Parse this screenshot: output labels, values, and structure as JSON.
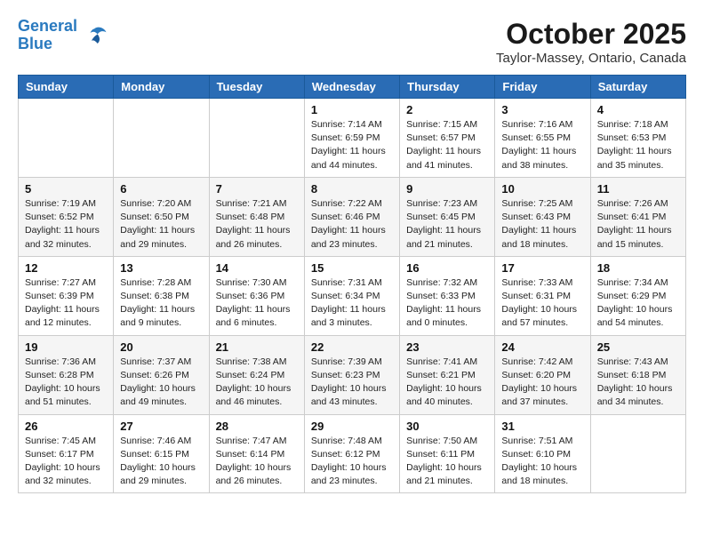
{
  "header": {
    "logo_line1": "General",
    "logo_line2": "Blue",
    "month_title": "October 2025",
    "location": "Taylor-Massey, Ontario, Canada"
  },
  "weekdays": [
    "Sunday",
    "Monday",
    "Tuesday",
    "Wednesday",
    "Thursday",
    "Friday",
    "Saturday"
  ],
  "weeks": [
    [
      {
        "day": "",
        "info": ""
      },
      {
        "day": "",
        "info": ""
      },
      {
        "day": "",
        "info": ""
      },
      {
        "day": "1",
        "info": "Sunrise: 7:14 AM\nSunset: 6:59 PM\nDaylight: 11 hours\nand 44 minutes."
      },
      {
        "day": "2",
        "info": "Sunrise: 7:15 AM\nSunset: 6:57 PM\nDaylight: 11 hours\nand 41 minutes."
      },
      {
        "day": "3",
        "info": "Sunrise: 7:16 AM\nSunset: 6:55 PM\nDaylight: 11 hours\nand 38 minutes."
      },
      {
        "day": "4",
        "info": "Sunrise: 7:18 AM\nSunset: 6:53 PM\nDaylight: 11 hours\nand 35 minutes."
      }
    ],
    [
      {
        "day": "5",
        "info": "Sunrise: 7:19 AM\nSunset: 6:52 PM\nDaylight: 11 hours\nand 32 minutes."
      },
      {
        "day": "6",
        "info": "Sunrise: 7:20 AM\nSunset: 6:50 PM\nDaylight: 11 hours\nand 29 minutes."
      },
      {
        "day": "7",
        "info": "Sunrise: 7:21 AM\nSunset: 6:48 PM\nDaylight: 11 hours\nand 26 minutes."
      },
      {
        "day": "8",
        "info": "Sunrise: 7:22 AM\nSunset: 6:46 PM\nDaylight: 11 hours\nand 23 minutes."
      },
      {
        "day": "9",
        "info": "Sunrise: 7:23 AM\nSunset: 6:45 PM\nDaylight: 11 hours\nand 21 minutes."
      },
      {
        "day": "10",
        "info": "Sunrise: 7:25 AM\nSunset: 6:43 PM\nDaylight: 11 hours\nand 18 minutes."
      },
      {
        "day": "11",
        "info": "Sunrise: 7:26 AM\nSunset: 6:41 PM\nDaylight: 11 hours\nand 15 minutes."
      }
    ],
    [
      {
        "day": "12",
        "info": "Sunrise: 7:27 AM\nSunset: 6:39 PM\nDaylight: 11 hours\nand 12 minutes."
      },
      {
        "day": "13",
        "info": "Sunrise: 7:28 AM\nSunset: 6:38 PM\nDaylight: 11 hours\nand 9 minutes."
      },
      {
        "day": "14",
        "info": "Sunrise: 7:30 AM\nSunset: 6:36 PM\nDaylight: 11 hours\nand 6 minutes."
      },
      {
        "day": "15",
        "info": "Sunrise: 7:31 AM\nSunset: 6:34 PM\nDaylight: 11 hours\nand 3 minutes."
      },
      {
        "day": "16",
        "info": "Sunrise: 7:32 AM\nSunset: 6:33 PM\nDaylight: 11 hours\nand 0 minutes."
      },
      {
        "day": "17",
        "info": "Sunrise: 7:33 AM\nSunset: 6:31 PM\nDaylight: 10 hours\nand 57 minutes."
      },
      {
        "day": "18",
        "info": "Sunrise: 7:34 AM\nSunset: 6:29 PM\nDaylight: 10 hours\nand 54 minutes."
      }
    ],
    [
      {
        "day": "19",
        "info": "Sunrise: 7:36 AM\nSunset: 6:28 PM\nDaylight: 10 hours\nand 51 minutes."
      },
      {
        "day": "20",
        "info": "Sunrise: 7:37 AM\nSunset: 6:26 PM\nDaylight: 10 hours\nand 49 minutes."
      },
      {
        "day": "21",
        "info": "Sunrise: 7:38 AM\nSunset: 6:24 PM\nDaylight: 10 hours\nand 46 minutes."
      },
      {
        "day": "22",
        "info": "Sunrise: 7:39 AM\nSunset: 6:23 PM\nDaylight: 10 hours\nand 43 minutes."
      },
      {
        "day": "23",
        "info": "Sunrise: 7:41 AM\nSunset: 6:21 PM\nDaylight: 10 hours\nand 40 minutes."
      },
      {
        "day": "24",
        "info": "Sunrise: 7:42 AM\nSunset: 6:20 PM\nDaylight: 10 hours\nand 37 minutes."
      },
      {
        "day": "25",
        "info": "Sunrise: 7:43 AM\nSunset: 6:18 PM\nDaylight: 10 hours\nand 34 minutes."
      }
    ],
    [
      {
        "day": "26",
        "info": "Sunrise: 7:45 AM\nSunset: 6:17 PM\nDaylight: 10 hours\nand 32 minutes."
      },
      {
        "day": "27",
        "info": "Sunrise: 7:46 AM\nSunset: 6:15 PM\nDaylight: 10 hours\nand 29 minutes."
      },
      {
        "day": "28",
        "info": "Sunrise: 7:47 AM\nSunset: 6:14 PM\nDaylight: 10 hours\nand 26 minutes."
      },
      {
        "day": "29",
        "info": "Sunrise: 7:48 AM\nSunset: 6:12 PM\nDaylight: 10 hours\nand 23 minutes."
      },
      {
        "day": "30",
        "info": "Sunrise: 7:50 AM\nSunset: 6:11 PM\nDaylight: 10 hours\nand 21 minutes."
      },
      {
        "day": "31",
        "info": "Sunrise: 7:51 AM\nSunset: 6:10 PM\nDaylight: 10 hours\nand 18 minutes."
      },
      {
        "day": "",
        "info": ""
      }
    ]
  ]
}
